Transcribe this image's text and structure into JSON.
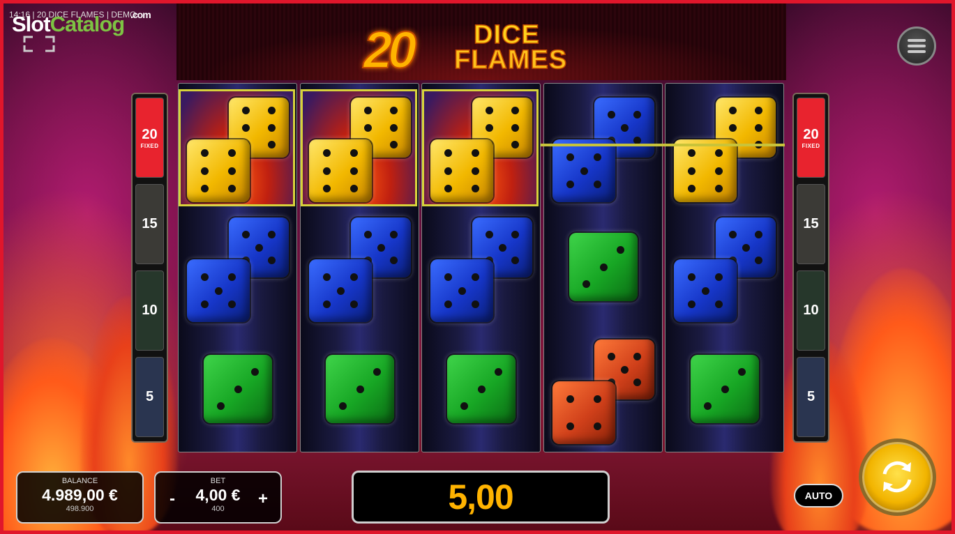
{
  "watermark": {
    "part1": "Slot",
    "part2": "Catalog",
    "domain": ".com"
  },
  "status_bar": "14:16 | 20 DICE FLAMES | DEMO",
  "game_logo": {
    "number": "20",
    "line1": "DICE",
    "line2": "FLAMES"
  },
  "paytable_left": [
    {
      "value": "20",
      "note": "FIXED",
      "color": "#e8232e"
    },
    {
      "value": "15",
      "note": "",
      "color": "#3b3a36"
    },
    {
      "value": "10",
      "note": "",
      "color": "#26372b"
    },
    {
      "value": "5",
      "note": "",
      "color": "#2a3550"
    }
  ],
  "paytable_right": [
    {
      "value": "20",
      "note": "FIXED",
      "color": "#e8232e"
    },
    {
      "value": "15",
      "note": "",
      "color": "#3b3a36"
    },
    {
      "value": "10",
      "note": "",
      "color": "#26372b"
    },
    {
      "value": "5",
      "note": "",
      "color": "#2a3550"
    }
  ],
  "reels": [
    [
      "yellow-double-dice",
      "blue-double-dice",
      "green-die"
    ],
    [
      "yellow-double-dice",
      "blue-double-dice",
      "green-die"
    ],
    [
      "yellow-double-dice",
      "blue-double-dice",
      "green-die"
    ],
    [
      "blue-double-dice",
      "green-die",
      "red-double-dice"
    ],
    [
      "yellow-double-dice",
      "blue-double-dice",
      "green-die"
    ]
  ],
  "balance": {
    "label": "BALANCE",
    "amount": "4.989,00 €",
    "credits": "498.900"
  },
  "bet": {
    "label": "BET",
    "amount": "4,00 €",
    "credits": "400",
    "minus": "-",
    "plus": "+"
  },
  "win": {
    "amount": "5,00"
  },
  "auto_label": "AUTO",
  "colors": {
    "frame": "#e0162b",
    "win_highlight": "#d7d23a",
    "win_text": "#ffb300"
  }
}
